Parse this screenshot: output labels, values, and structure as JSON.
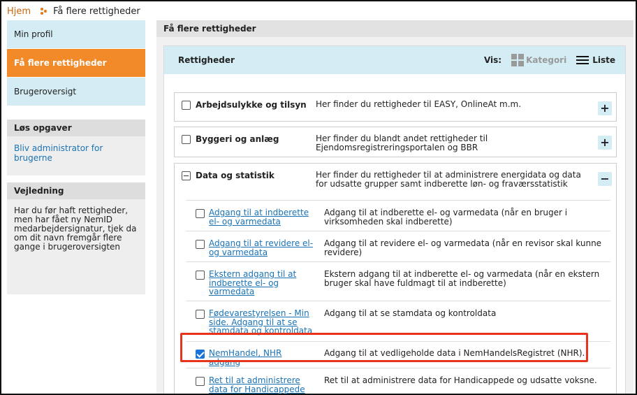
{
  "breadcrumb": {
    "home": "Hjem",
    "current": "Få flere rettigheder"
  },
  "sidebar": {
    "items": [
      {
        "label": "Min profil"
      },
      {
        "label": "Få flere rettigheder"
      },
      {
        "label": "Brugeroversigt"
      }
    ],
    "tasks": {
      "title": "Løs opgaver",
      "link": "Bliv administrator for brugerne"
    },
    "guide": {
      "title": "Vejledning",
      "text": "Har du før haft rettigheder, men har fået ny NemID medarbejdersignatur, tjek da om dit navn fremgår flere gange i brugeroversigten"
    }
  },
  "main": {
    "title": "Få flere rettigheder",
    "panel_title": "Rettigheder",
    "vis_label": "Vis:",
    "view_category": "Kategori",
    "view_list": "Liste"
  },
  "categories": [
    {
      "title": "Arbejdsulykke og tilsyn",
      "desc": "Her finder du rettigheder til EASY, OnlineAt m.m.",
      "toggle": "+"
    },
    {
      "title": "Byggeri og anlæg",
      "desc": "Her finder du blandt andet rettigheder til Ejendomsregistreringsportalen og BBR",
      "toggle": "+"
    },
    {
      "title": "Data og statistik",
      "desc": "Her finder du rettigheder til at administrere energidata og data for udsatte grupper samt indberette løn- og fraværsstatistik",
      "toggle": "−"
    }
  ],
  "subs": [
    {
      "link": "Adgang til at indberette el- og varmedata",
      "desc": "Adgang til at indberette el- og varmedata (når en bruger i virksomheden skal indberette)"
    },
    {
      "link": "Adgang til at revidere el- og varmedata",
      "desc": "Adgang til at revidere el- og varmedata (når en revisor skal kunne revidere)"
    },
    {
      "link": "Ekstern adgang til at indberette el- og varmedata",
      "desc": "Ekstern adgang til at indberette el- og varmedata (når en ekstern bruger skal have fuldmagt til at indberette)"
    },
    {
      "link": "Fødevarestyrelsen - Min side. Adgang til at se stamdata og kontroldata",
      "desc": "Adgang til at se stamdata og kontroldata"
    },
    {
      "link": "NemHandel, NHR adgang",
      "desc": "Adgang til at vedligeholde data i NemHandelsRegistret (NHR).",
      "checked": true
    },
    {
      "link": "Ret til at administrere data for Handicappede og udsatte voksne",
      "desc": "Ret til at administrere data for Handicappede og udsatte voksne."
    }
  ],
  "colors": {
    "accent": "#f28a2a",
    "light_blue": "#d4edf5",
    "link": "#1a73b5",
    "highlight": "#e8341c"
  }
}
